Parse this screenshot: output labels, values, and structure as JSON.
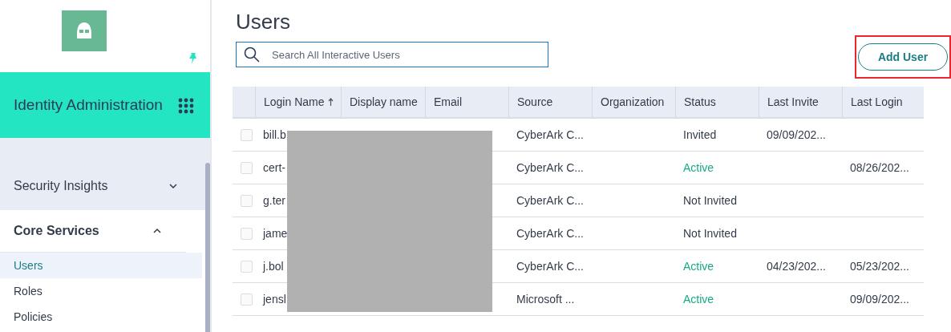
{
  "sidebar": {
    "app_title": "Identity Administration",
    "sections": [
      {
        "label": "Security Insights",
        "expanded": false
      },
      {
        "label": "Core Services",
        "expanded": true,
        "items": [
          {
            "label": "Users",
            "selected": true
          },
          {
            "label": "Roles",
            "selected": false
          },
          {
            "label": "Policies",
            "selected": false
          }
        ]
      }
    ]
  },
  "page": {
    "title": "Users",
    "search": {
      "placeholder": "Search All Interactive Users"
    },
    "add_button": "Add User"
  },
  "table": {
    "columns": [
      {
        "label": "Login Name",
        "sorted": true
      },
      {
        "label": "Display name",
        "sorted": false
      },
      {
        "label": "Email",
        "sorted": false
      },
      {
        "label": "Source",
        "sorted": false
      },
      {
        "label": "Organization",
        "sorted": false
      },
      {
        "label": "Status",
        "sorted": false
      },
      {
        "label": "Last Invite",
        "sorted": false
      },
      {
        "label": "Last Login",
        "sorted": false
      }
    ],
    "rows": [
      {
        "checked": false,
        "login": "bill.b",
        "source": "CyberArk C...",
        "status": {
          "text": "Invited",
          "color": "#333b4a"
        },
        "last_invite": "09/09/202...",
        "last_login": ""
      },
      {
        "checked": false,
        "login": "cert-",
        "source": "CyberArk C...",
        "status": {
          "text": "Active",
          "color": "#1aa886"
        },
        "last_invite": "",
        "last_login": "08/26/202..."
      },
      {
        "checked": false,
        "login": "g.ter",
        "source": "CyberArk C...",
        "status": {
          "text": "Not Invited",
          "color": "#333b4a"
        },
        "last_invite": "",
        "last_login": ""
      },
      {
        "checked": false,
        "login": "jame",
        "source": "CyberArk C...",
        "status": {
          "text": "Not Invited",
          "color": "#333b4a"
        },
        "last_invite": "",
        "last_login": ""
      },
      {
        "checked": false,
        "login": "j.bol",
        "source": "CyberArk C...",
        "status": {
          "text": "Active",
          "color": "#1aa886"
        },
        "last_invite": "04/23/202...",
        "last_login": "05/23/202..."
      },
      {
        "checked": false,
        "login": "jensl",
        "source": "Microsoft ...",
        "status": {
          "text": "Active",
          "color": "#1aa886"
        },
        "last_invite": "",
        "last_login": "09/09/202..."
      }
    ]
  }
}
